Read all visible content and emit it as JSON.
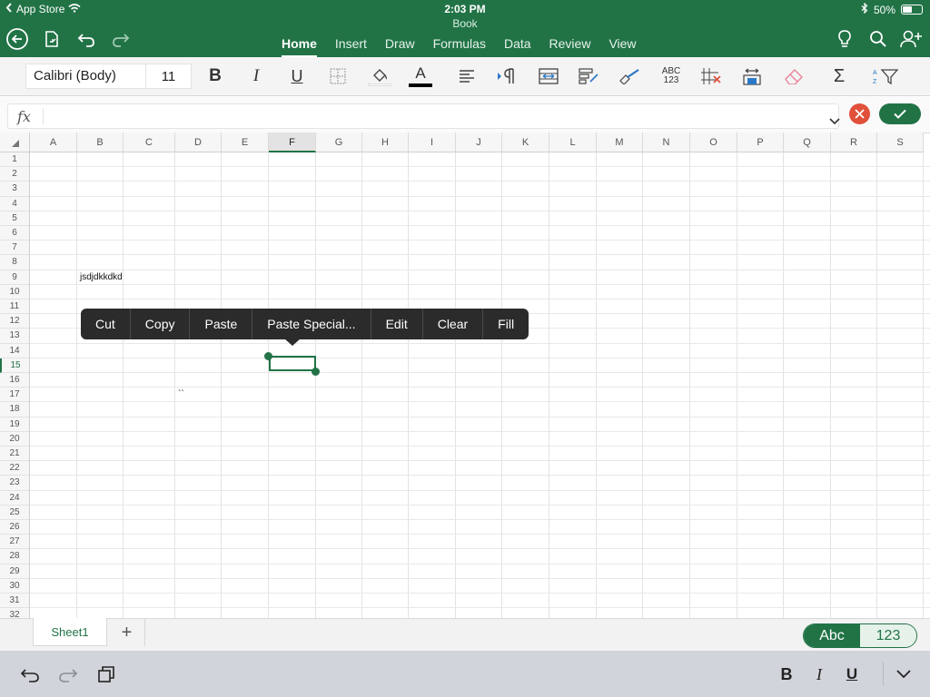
{
  "status_bar": {
    "back_app": "App Store",
    "time": "2:03 PM",
    "battery": "50%",
    "battery_level": 0.5
  },
  "document": {
    "title": "Book"
  },
  "tabs": [
    {
      "label": "Home",
      "active": true
    },
    {
      "label": "Insert",
      "active": false
    },
    {
      "label": "Draw",
      "active": false
    },
    {
      "label": "Formulas",
      "active": false
    },
    {
      "label": "Data",
      "active": false
    },
    {
      "label": "Review",
      "active": false
    },
    {
      "label": "View",
      "active": false
    }
  ],
  "ribbon": {
    "font_name": "Calibri (Body)",
    "font_size": "11",
    "bold": "B",
    "italic": "I",
    "underline": "U",
    "font_color": "A",
    "spelling_top": "ABC",
    "spelling_bottom": "123",
    "sum": "Σ"
  },
  "formula_bar": {
    "fx_label": "fx",
    "value": ""
  },
  "grid": {
    "columns": [
      "A",
      "B",
      "C",
      "D",
      "E",
      "F",
      "G",
      "H",
      "I",
      "J",
      "K",
      "L",
      "M",
      "N",
      "O",
      "P",
      "Q",
      "R",
      "S"
    ],
    "active_column": "F",
    "rows": [
      1,
      2,
      3,
      4,
      5,
      6,
      7,
      8,
      9,
      10,
      11,
      12,
      13,
      14,
      15,
      16,
      17,
      18,
      19,
      20,
      21,
      22,
      23,
      24,
      25,
      26,
      27,
      28,
      29,
      30,
      31,
      32
    ],
    "active_row": 15,
    "cells": {
      "B9": "jsdjdkkdkd",
      "D17": "``"
    }
  },
  "context_menu": [
    "Cut",
    "Copy",
    "Paste",
    "Paste Special...",
    "Edit",
    "Clear",
    "Fill"
  ],
  "sheets": {
    "tabs": [
      "Sheet1"
    ],
    "add_label": "+"
  },
  "keyboard_toggle": {
    "abc": "Abc",
    "num": "123"
  },
  "keyboard_toolbar": {
    "bold": "B",
    "italic": "I",
    "underline": "U"
  },
  "colors": {
    "accent": "#217346",
    "cancel": "#e0503a",
    "menu_bg": "#2b2b2b"
  }
}
